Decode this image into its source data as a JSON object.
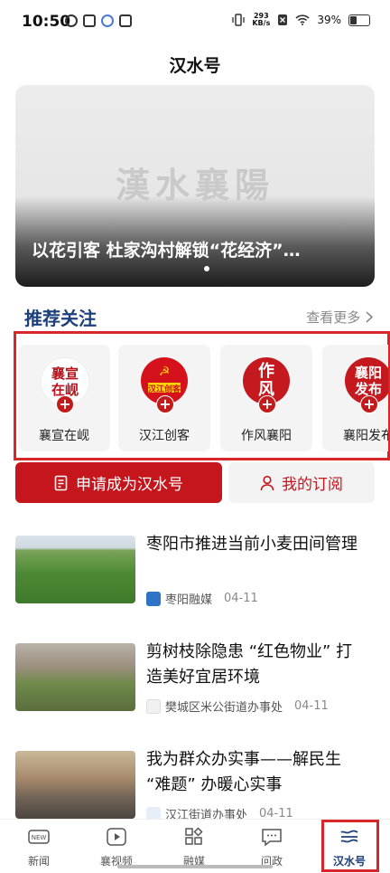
{
  "status_bar": {
    "time": "10:50",
    "net_speed_value": "293",
    "net_speed_unit": "KB/s",
    "battery": "39%"
  },
  "header": {
    "title": "汉水号"
  },
  "banner": {
    "logo_text": "漢水襄陽",
    "title": "以花引客 杜家沟村解锁“花经济”…"
  },
  "recommend": {
    "title": "推荐关注",
    "more": "查看更多",
    "accounts": [
      {
        "name": "襄宣在岘",
        "avatar_text": "襄宣\n在岘"
      },
      {
        "name": "汉江创客",
        "avatar_text": "汉江创客"
      },
      {
        "name": "作风襄阳",
        "avatar_text": "作风"
      },
      {
        "name": "襄阳发布",
        "avatar_text": "襄阳\n发布"
      }
    ]
  },
  "actions": {
    "apply": "申请成为汉水号",
    "subscriptions": "我的订阅"
  },
  "news": [
    {
      "title": "枣阳市推进当前小麦田间管理",
      "source": "枣阳融媒",
      "date": "04-11"
    },
    {
      "title": "剪树枝除隐患 “红色物业” 打造美好宜居环境",
      "source": "樊城区米公街道办事处",
      "date": "04-11"
    },
    {
      "title": "我为群众办实事——解民生 “难题” 办暖心实事",
      "source": "汉江街道办事处",
      "date": "04-11"
    }
  ],
  "tabbar": {
    "items": [
      {
        "label": "新闻",
        "icon": "news-icon"
      },
      {
        "label": "襄视频",
        "icon": "video-icon"
      },
      {
        "label": "融媒",
        "icon": "grid-icon"
      },
      {
        "label": "问政",
        "icon": "message-icon"
      },
      {
        "label": "汉水号",
        "icon": "hanshui-icon"
      }
    ],
    "active_index": 4
  },
  "colors": {
    "brand_red": "#c4161c",
    "title_blue": "#1d3f7a"
  }
}
